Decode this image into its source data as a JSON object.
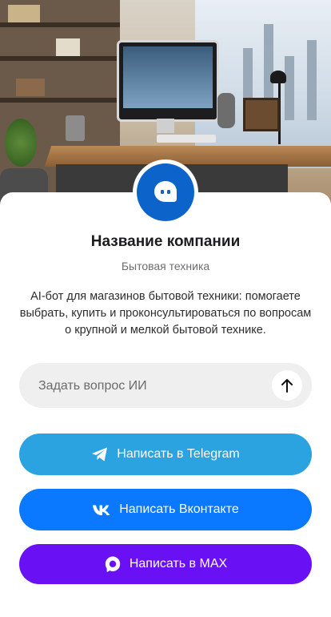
{
  "company": {
    "name": "Название компании",
    "category": "Бытовая техника",
    "description": "AI-бот для магазинов бытовой техники: помогаете выбрать, купить и проконсультироваться по вопросам о крупной и мелкой бытовой технике.",
    "avatar_icon": "chat-bot-icon"
  },
  "ask": {
    "placeholder": "Задать вопрос ИИ",
    "value": "",
    "send_icon": "arrow-up-icon"
  },
  "actions": {
    "telegram": {
      "label": "Написать в Telegram",
      "icon": "telegram-icon"
    },
    "vk": {
      "label": "Написать Вконтакте",
      "icon": "vk-icon"
    },
    "max": {
      "label": "Написать в MAX",
      "icon": "max-chat-icon"
    }
  },
  "colors": {
    "avatar": "#0c63c9",
    "telegram": "#2aa3e0",
    "vk": "#0a78ff",
    "max": "#6a10f5",
    "input_bg": "#efefef"
  }
}
